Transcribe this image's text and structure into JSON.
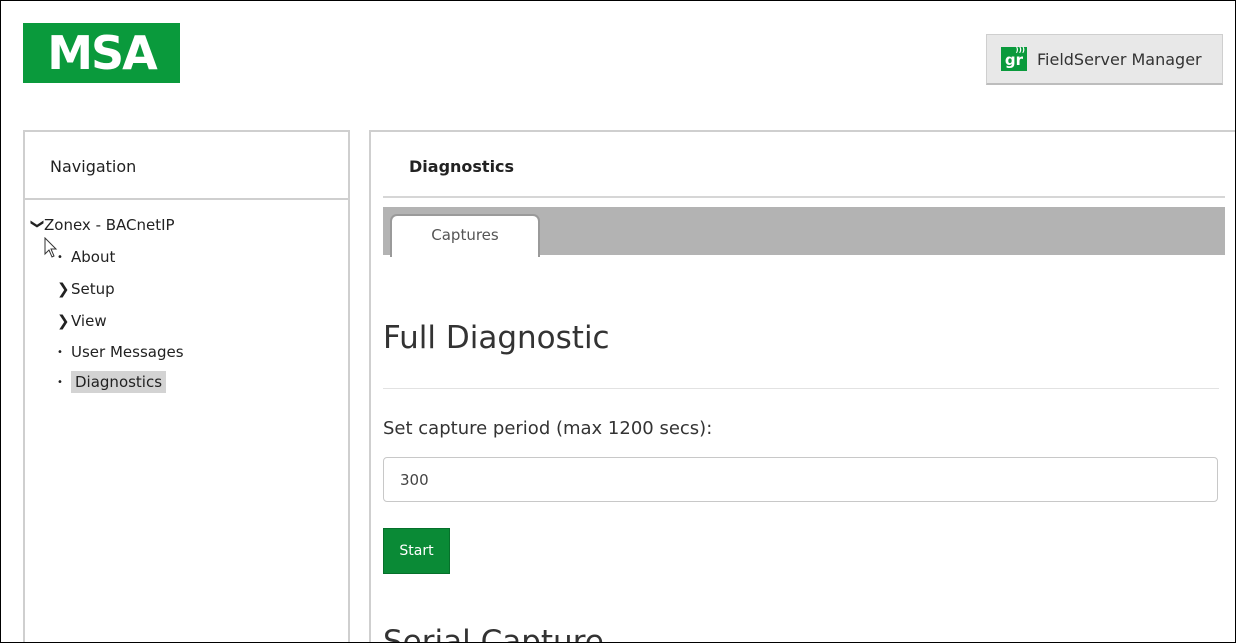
{
  "brand": {
    "logo_text": "MSA",
    "accent": "#0a9a3c"
  },
  "header": {
    "fsm_button_label": "FieldServer Manager",
    "fsm_icon_text": "gr"
  },
  "navigation": {
    "title": "Navigation",
    "root": "Zonex - BACnetIP",
    "items": [
      {
        "label": "About",
        "kind": "leaf"
      },
      {
        "label": "Setup",
        "kind": "collapsed"
      },
      {
        "label": "View",
        "kind": "collapsed"
      },
      {
        "label": "User Messages",
        "kind": "leaf"
      },
      {
        "label": "Diagnostics",
        "kind": "leaf",
        "selected": true
      }
    ]
  },
  "main": {
    "title": "Diagnostics",
    "tabs": [
      {
        "label": "Captures",
        "active": true
      }
    ],
    "section_heading": "Full Diagnostic",
    "capture_label": "Set capture period (max 1200 secs):",
    "capture_value": "300",
    "start_label": "Start",
    "next_section_heading": "Serial Capture"
  }
}
